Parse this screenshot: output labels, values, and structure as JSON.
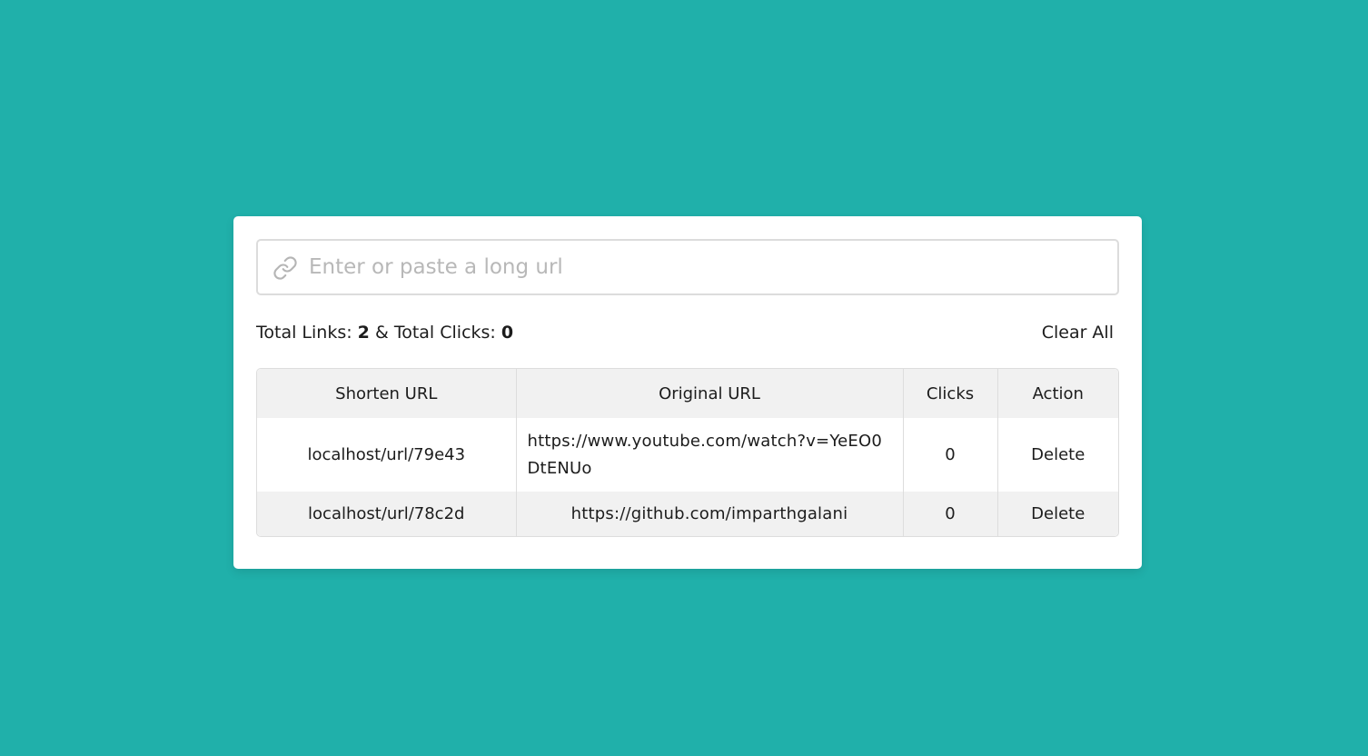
{
  "colors": {
    "background": "#20b0aa",
    "card": "#ffffff",
    "header_row": "#f1f1f1",
    "border": "#dddddd"
  },
  "input": {
    "icon": "link-icon",
    "placeholder": "Enter or paste a long url",
    "value": ""
  },
  "stats": {
    "links_label": "Total Links:",
    "links_count": "2",
    "separator": "&",
    "clicks_label": "Total Clicks:",
    "clicks_count": "0"
  },
  "clear_all_label": "Clear All",
  "table": {
    "headers": [
      "Shorten URL",
      "Original URL",
      "Clicks",
      "Action"
    ],
    "rows": [
      {
        "short_url": "localhost/url/79e43",
        "original_url": "https://www.youtube.com/watch?v=YeEO0DtENUo",
        "clicks": "0",
        "action": "Delete"
      },
      {
        "short_url": "localhost/url/78c2d",
        "original_url": "https://github.com/imparthgalani",
        "clicks": "0",
        "action": "Delete"
      }
    ]
  }
}
